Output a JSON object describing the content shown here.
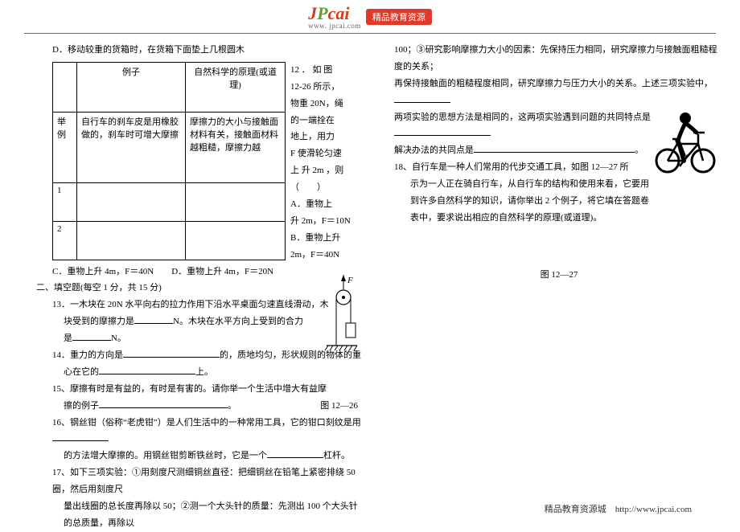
{
  "header": {
    "logo_j": "J",
    "logo_p": "P",
    "logo_cai": "cai",
    "logo_url": "www. jpcai.com",
    "badge": "精品教育资源"
  },
  "left": {
    "line_d": "D．移动较重的货箱时，在货箱下面垫上几根圆木",
    "table": {
      "h1": "例子",
      "h2": "自然科学的原理(或道理)",
      "r0a": "举例",
      "r0b": "自行车的刹车皮是用橡胶做的，刹车时可增大摩擦",
      "r0c": "摩擦力的大小与接触面材料有关，接触面材料越粗糙，摩擦力越",
      "r1a": "1",
      "r2a": "2"
    },
    "side": {
      "s1": "12 ． 如 图",
      "s2": "12-26 所示，",
      "s3": "物重 20N，绳",
      "s4": "的一端拴在",
      "s5": "地上，用力",
      "s6": "F 使滑轮匀速",
      "s7": "上 升 2m ，则",
      "s8": "（　　）",
      "s9": "A．重物上",
      "s10": "升 2m，F＝10N",
      "s11": "B．重物上升",
      "s12": "2m，F＝40N"
    },
    "q12_cd": "C．重物上升 4m，F＝40N　　D．重物上升 4m，F＝20N",
    "sec2": "二、填空题(每空 1 分，共 15 分)",
    "q13a": "13．一木块在 20N 水平向右的拉力作用下沿水平桌面匀速直线滑动，木",
    "q13b": "块受到的摩擦力是",
    "q13c": "N。木块在水平方向上受到的合力",
    "q13d": "是",
    "q13e": "N。",
    "q14a": "14．重力的方向是",
    "q14b": "的，质地均匀，形状规则的物体的重",
    "q14c": "心在它的",
    "q14d": "上。",
    "q15a": "15、摩擦有时是有益的，有时是有害的。请你举一个生活中增大有益摩",
    "q15b": "擦的例子",
    "fig1226": "图 12—26",
    "q16a": "16、钢丝钳（俗称“老虎钳”）是人们生活中的一种常用工具，它的钳口刻纹是用",
    "q16b": "的方法增大摩擦的。用钢丝钳剪断铁丝时，它是一个",
    "q16c": "杠杆。",
    "q17a": "17、如下三项实验：①用刻度尺测细铜丝直径：把细铜丝在铅笔上紧密排绕 50 圈，然后用刻度尺",
    "q17b": "量出线圈的总长度再除以 50；②测一个大头针的质量：先测出 100 个大头针的总质量，再除以"
  },
  "right": {
    "r1": "100；③研究影响摩擦力大小的因素：先保持压力相同，研究摩擦力与接触面粗糙程度的关系；",
    "r2": "再保持接触面的粗糙程度相同，研究摩擦力与压力大小的关系。上述三项实验中，",
    "r3": "两项实验的思想方法是相同的，这两项实验遇到问题的共同特点是",
    "r4": "解决办法的共同点是",
    "q18a": "18、自行车是一种人们常用的代步交通工具，如图 12—27 所",
    "q18b": "示为一人正在骑自行车，从自行车的结构和使用来看，它要用",
    "q18c": "到许多自然科学的知识，请你举出 2 个例子，将它填在答题卷",
    "q18d": "表中，要求说出相应的自然科学的原理(或道理)。",
    "fig1227": "图 12—27"
  },
  "footer": {
    "text": "精品教育资源城　http://www.jpcai.com"
  }
}
